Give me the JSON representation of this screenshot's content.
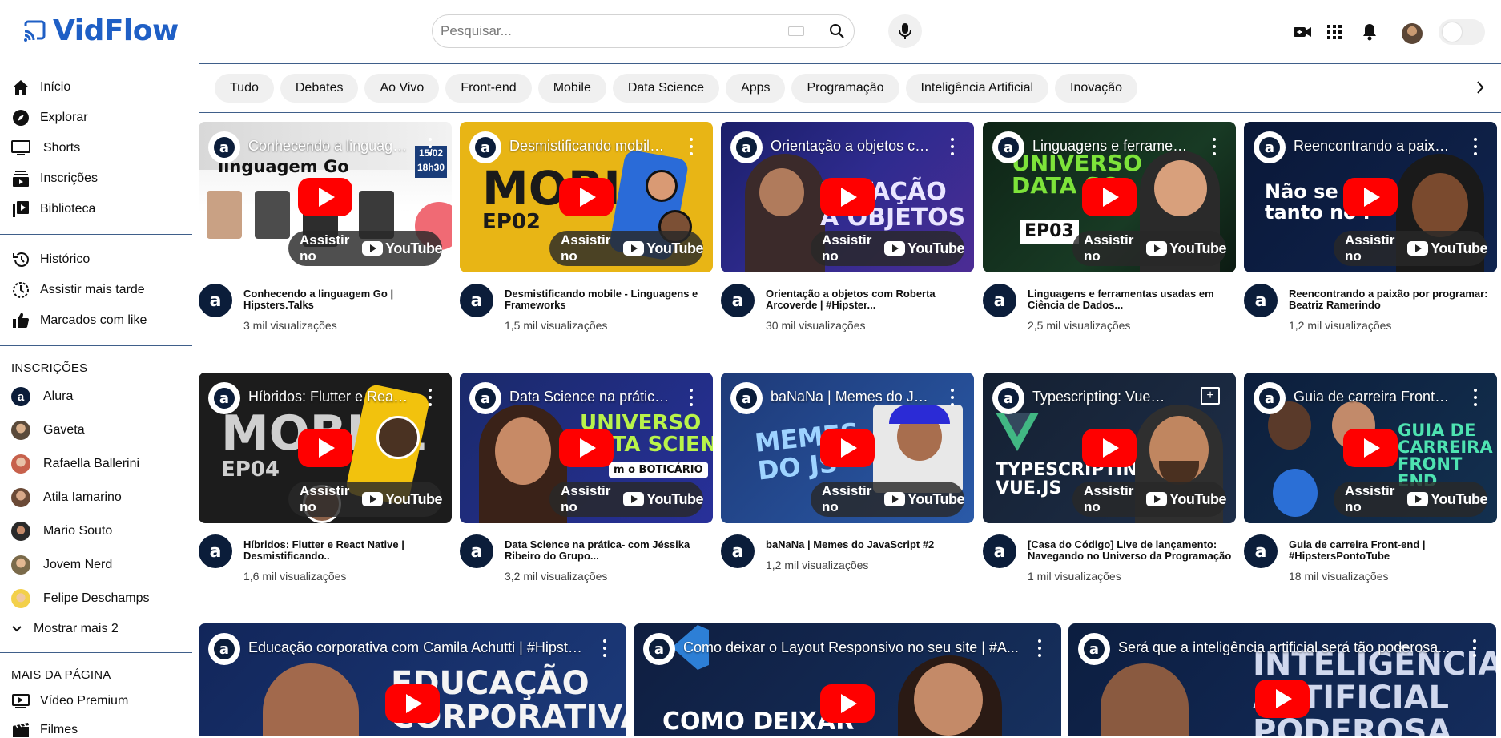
{
  "header": {
    "brand": "VidFlow",
    "search_placeholder": "Pesquisar...",
    "colors": {
      "brand": "#1f5fc5",
      "divider": "#3f5f8a",
      "play": "#ff0000"
    }
  },
  "sidebar": {
    "main": [
      {
        "label": "Início",
        "icon": "home-icon"
      },
      {
        "label": "Explorar",
        "icon": "compass-icon"
      },
      {
        "label": "Shorts",
        "icon": "shorts-icon"
      },
      {
        "label": "Inscrições",
        "icon": "subscriptions-icon"
      },
      {
        "label": "Biblioteca",
        "icon": "library-icon"
      }
    ],
    "secondary": [
      {
        "label": "Histórico",
        "icon": "history-icon"
      },
      {
        "label": "Assistir mais tarde",
        "icon": "clock-icon"
      },
      {
        "label": "Marcados com like",
        "icon": "thumbs-up-icon"
      }
    ],
    "subscriptions_heading": "INSCRIÇÕES",
    "subscriptions": [
      {
        "label": "Alura"
      },
      {
        "label": "Gaveta"
      },
      {
        "label": "Rafaella Ballerini"
      },
      {
        "label": "Atila Iamarino"
      },
      {
        "label": "Mario Souto"
      },
      {
        "label": "Jovem Nerd"
      },
      {
        "label": "Felipe Deschamps"
      }
    ],
    "show_more": "Mostrar mais 2",
    "more_heading": "MAIS DA PÁGINA",
    "more": [
      {
        "label": "Vídeo Premium",
        "icon": "premium-video-icon"
      },
      {
        "label": "Filmes",
        "icon": "film-icon"
      }
    ]
  },
  "chips": [
    "Tudo",
    "Debates",
    "Ao Vivo",
    "Front-end",
    "Mobile",
    "Data Science",
    "Apps",
    "Programação",
    "Inteligência Artificial",
    "Inovação"
  ],
  "watch_on": "Assistir no",
  "youtube": "YouTube",
  "videos": [
    {
      "thumb_title": "Conhecendo a linguagem Go...",
      "title": "Conhecendo a linguagem Go | Hipsters.Talks",
      "views": "3 mil visualizações"
    },
    {
      "thumb_title": "Desmistificando mobile...",
      "title": "Desmistificando mobile - Linguagens e Frameworks",
      "views": "1,5 mil visualizações"
    },
    {
      "thumb_title": "Orientação a objetos com...",
      "title": "Orientação a objetos com Roberta Arcoverde | #Hipster...",
      "views": "30 mil visualizações"
    },
    {
      "thumb_title": "Linguagens e ferramentas...",
      "title": "Linguagens e ferramentas usadas em Ciência de Dados...",
      "views": "2,5 mil visualizações"
    },
    {
      "thumb_title": "Reencontrando a paixão...",
      "title": "Reencontrando a paixão por programar: Beatriz Ramerindo",
      "views": "1,2 mil visualizações"
    },
    {
      "thumb_title": "Híbridos: Flutter e React...",
      "title": "Híbridos: Flutter e React Native | Desmistificando..",
      "views": "1,6 mil visualizações"
    },
    {
      "thumb_title": "Data Science na prática...",
      "title": "Data Science na prática- com Jéssika Ribeiro do Grupo...",
      "views": "3,2 mil visualizações"
    },
    {
      "thumb_title": "baNaNa | Memes do JavaScript",
      "title": "baNaNa | Memes do JavaScript #2",
      "views": "1,2 mil visualizações"
    },
    {
      "thumb_title": "Typescripting: Vue.js | ...",
      "title": "[Casa do Código] Live de lançamento: Navegando no Universo da Programação",
      "views": "1 mil visualizações"
    },
    {
      "thumb_title": "Guia de carreira Front-end...",
      "title": "Guia de carreira Front-end | #HipstersPontoTube",
      "views": "18 mil visualizações"
    }
  ],
  "wide_videos": [
    {
      "thumb_title": "Educação corporativa com Camila Achutti | #Hipsters..."
    },
    {
      "thumb_title": "Como deixar o Layout Responsivo no seu site | #A..."
    },
    {
      "thumb_title": "Será que a inteligência artificial será tão poderosa..."
    }
  ],
  "thumb_text": {
    "go": "linguagem Go",
    "go_date": "15/02",
    "go_time": "18h30",
    "mobile": "MOBILE",
    "ep02": "EP02",
    "oo": "ENTAÇÃO\nA OBJETOS",
    "ds": "UNIVERSO\nDATA SC",
    "ep03": "EP03",
    "nao": "Não se co\ntanto no i",
    "ep04": "EP04",
    "ds2": "UNIVERSO\nDATA SCIENCE",
    "boticario": "m o BOTICÁRIO",
    "memes": "MEMES\nDO JS",
    "vue": "TYPESCRIPTING:\nVUE.JS",
    "guia": "GUIA DE\nCARREIRA\nFRONT\nEND",
    "educ": "EDUCAÇÃO\nCORPORATIVA",
    "como": "COMO DEIXAR",
    "ia": "INTELIGÊNCIA\nARTIFICIAL\nPODEROSA"
  }
}
